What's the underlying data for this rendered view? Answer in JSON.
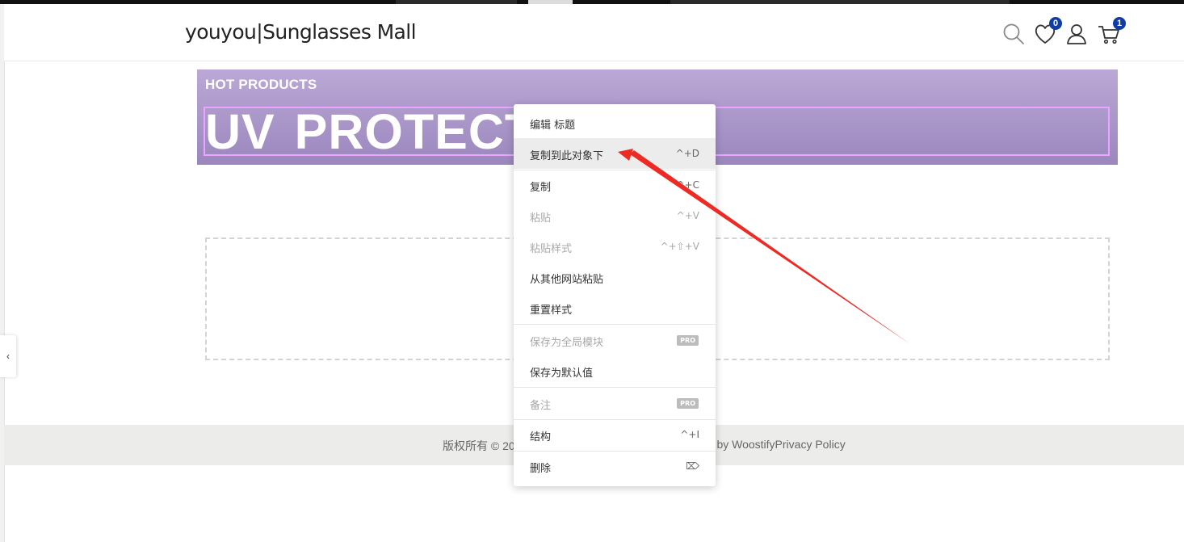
{
  "header": {
    "site_title": "youyou|Sunglasses Mall",
    "wishlist_count": "0",
    "cart_count": "1"
  },
  "banner": {
    "subtitle": "HOT PRODUCTS",
    "title": "UV PROTECTI"
  },
  "footer": {
    "left_text": "版权所有 © 20",
    "right_text": "ed by WoostifyPrivacy Policy"
  },
  "sidebar_toggle": "‹",
  "context_menu": {
    "items": [
      {
        "label": "编辑 标题",
        "shortcut": ""
      },
      {
        "label": "复制到此对象下",
        "shortcut": "^+D"
      },
      {
        "label": "复制",
        "shortcut": "^+C"
      },
      {
        "label": "粘贴",
        "shortcut": "^+V"
      },
      {
        "label": "粘贴样式",
        "shortcut": "^+⇧+V"
      },
      {
        "label": "从其他网站粘贴",
        "shortcut": ""
      },
      {
        "label": "重置样式",
        "shortcut": ""
      },
      {
        "label": "保存为全局模块",
        "badge": "PRO"
      },
      {
        "label": "保存为默认值",
        "shortcut": ""
      },
      {
        "label": "备注",
        "badge": "PRO"
      },
      {
        "label": "结构",
        "shortcut": "^+I"
      },
      {
        "label": "删除",
        "shortcut": "⌦"
      }
    ]
  },
  "colors": {
    "accent_badge": "#0f3da3",
    "banner_start": "#bba8d6",
    "banner_end": "#9b87bd",
    "annotation_arrow": "#ee2a24"
  }
}
